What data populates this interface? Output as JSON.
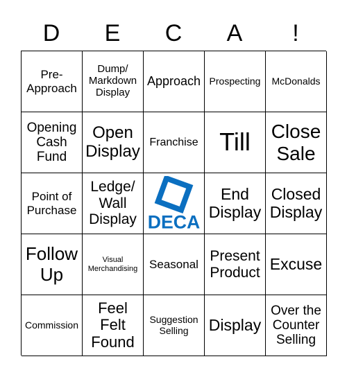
{
  "header": [
    "D",
    "E",
    "C",
    "A",
    "!"
  ],
  "cells": [
    "Pre-\nApproach",
    "Dump/\nMarkdown\nDisplay",
    "Approach",
    "Prospecting",
    "McDonalds",
    "Opening\nCash\nFund",
    "Open\nDisplay",
    "Franchise",
    "Till",
    "Close\nSale",
    "Point of\nPurchase",
    "Ledge/\nWall\nDisplay",
    "",
    "End\nDisplay",
    "Closed\nDisplay",
    "Follow\nUp",
    "Visual\nMerchandising",
    "Seasonal",
    "Present\nProduct",
    "Excuse",
    "Commission",
    "Feel\nFelt\nFound",
    "Suggestion\nSelling",
    "Display",
    "Over the\nCounter\nSelling"
  ],
  "logo": {
    "text": "DECA",
    "color": "#0b6fc0"
  }
}
